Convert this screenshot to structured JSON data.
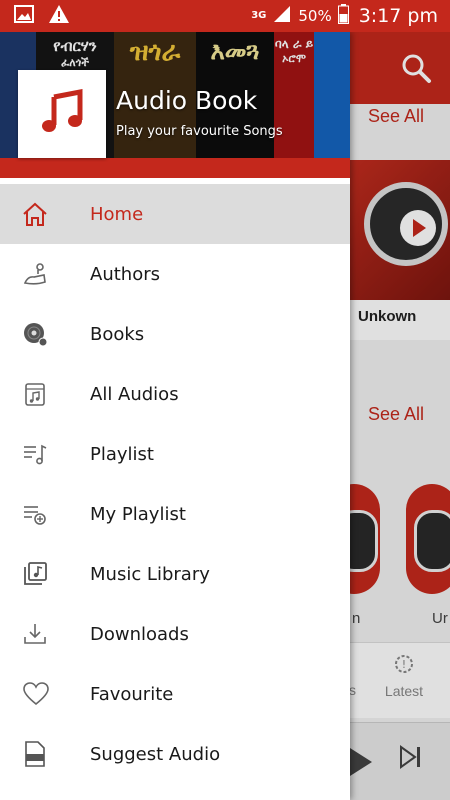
{
  "status_bar": {
    "network": "3G",
    "battery": "50%",
    "time": "3:17 pm"
  },
  "background": {
    "see_all_1": "See All",
    "see_all_2": "See All",
    "card_title": "Unkown",
    "caption_1": "n",
    "caption_2": "Ur",
    "nav_partial": "s",
    "nav_latest": "Latest"
  },
  "drawer": {
    "app_title": "Audio Book",
    "app_subtitle": "Play your favourite Songs",
    "covers": [
      {
        "title": "",
        "sub": "",
        "bg": "#1e3a6e",
        "fg": "#f0c040"
      },
      {
        "title": "የብርሃን",
        "sub": "ፈለጎች",
        "bg": "#151515",
        "fg": "#ffffff"
      },
      {
        "title": "ዝጎራ",
        "sub": "",
        "bg": "#3d2a12",
        "fg": "#f2c63a"
      },
      {
        "title": "እመጓ",
        "sub": "",
        "bg": "#0d0d0d",
        "fg": "#f4e89a"
      },
      {
        "title": "ባላ ራ ይ",
        "sub": "ኦሮሞ",
        "bg": "#a41414",
        "fg": "#ffffff"
      },
      {
        "title": "",
        "sub": "",
        "bg": "#1565c0",
        "fg": "#ffffff"
      }
    ],
    "menu": [
      {
        "label": "Home",
        "icon": "home-icon"
      },
      {
        "label": "Authors",
        "icon": "authors-icon"
      },
      {
        "label": "Books",
        "icon": "books-disc-icon"
      },
      {
        "label": "All Audios",
        "icon": "audio-file-icon"
      },
      {
        "label": "Playlist",
        "icon": "playlist-icon"
      },
      {
        "label": "My Playlist",
        "icon": "playlist-add-icon"
      },
      {
        "label": "Music Library",
        "icon": "music-library-icon"
      },
      {
        "label": "Downloads",
        "icon": "download-icon"
      },
      {
        "label": "Favourite",
        "icon": "heart-icon"
      },
      {
        "label": "Suggest Audio",
        "icon": "mp3-file-icon"
      }
    ],
    "active_item": "Home"
  },
  "colors": {
    "accent": "#c4281c",
    "active_background": "#dcdcdc"
  }
}
